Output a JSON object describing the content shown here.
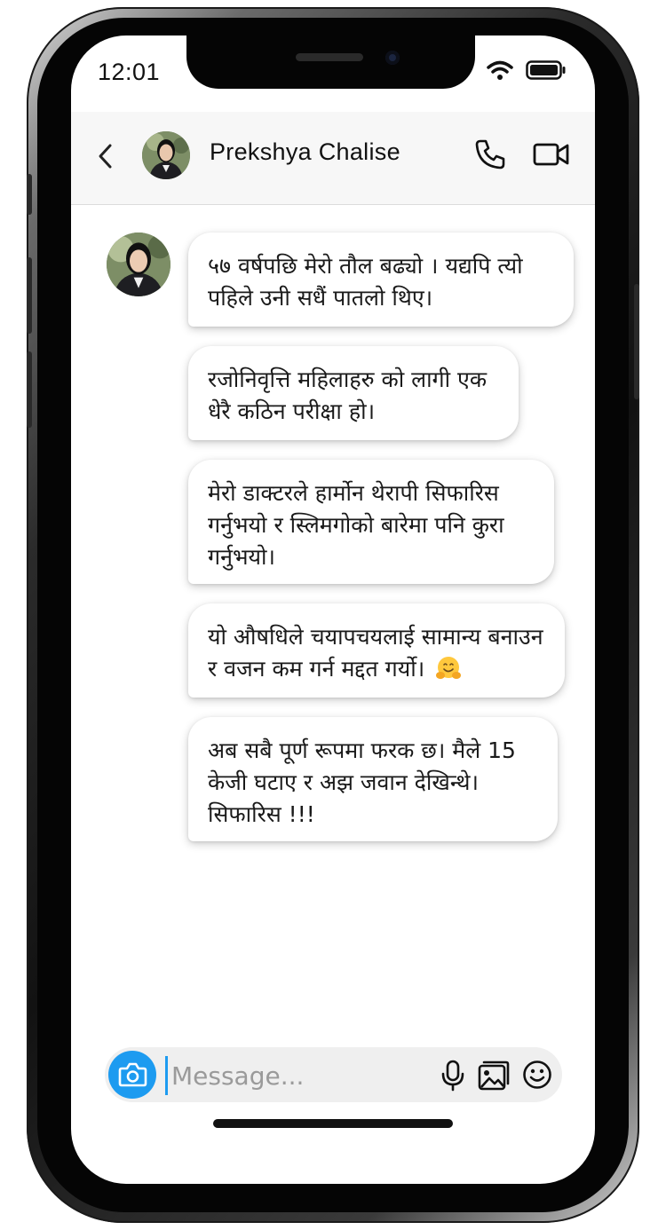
{
  "status_bar": {
    "time": "12:01"
  },
  "header": {
    "contact_name": "Prekshya Chalise"
  },
  "messages": [
    {
      "text": "५७ वर्षपछि मेरो तौल बढ्यो । यद्यपि त्यो पहिले उनी सधैं पातलो थिए।"
    },
    {
      "text": "रजोनिवृत्ति महिलाहरु को लागी एक धेरै कठिन परीक्षा हो।"
    },
    {
      "text": "मेरो डाक्टरले हार्मोन थेरापी सिफारिस गर्नुभयो र स्लिमगोको बारेमा पनि कुरा गर्नुभयो।"
    },
    {
      "text": "यो औषधिले चयापचयलाई सामान्य बनाउन र वजन कम गर्न मद्दत गर्यो।",
      "emoji": "hugging-face"
    },
    {
      "text": "अब सबै पूर्ण रूपमा फरक छ। मैले 15 केजी घटाए र अझ जवान देखिन्थे। सिफारिस !!!"
    }
  ],
  "composer": {
    "placeholder": "Message...",
    "value": ""
  },
  "icons": {
    "back": "chevron-left-icon",
    "call": "phone-icon",
    "video": "video-camera-icon",
    "camera": "camera-icon",
    "mic": "microphone-icon",
    "gallery": "image-gallery-icon",
    "emoji": "smiley-icon"
  },
  "colors": {
    "accent": "#1d9bf0",
    "header_bg": "#f7f7f7",
    "bubble_bg": "#ffffff"
  }
}
